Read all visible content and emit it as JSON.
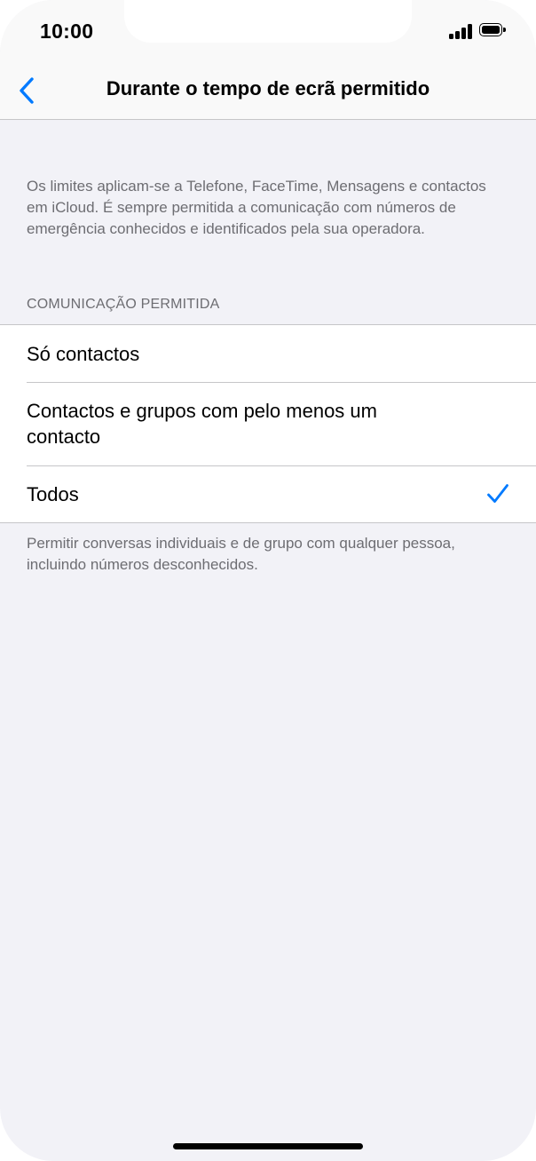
{
  "status_bar": {
    "time": "10:00",
    "signal_icon": "cellular-signal-icon",
    "battery_icon": "battery-full-icon"
  },
  "nav": {
    "back_icon": "chevron-left-icon",
    "title": "Durante o tempo de ecrã permitido",
    "accent_color": "#007aff"
  },
  "intro_note": "Os limites aplicam-se a Telefone, FaceTime, Mensagens e contactos em iCloud. É sempre permitida a comunicação com números de emergência conhecidos e identificados pela sua operadora.",
  "section": {
    "header": "COMUNICAÇÃO PERMITIDA",
    "options": [
      {
        "label": "Só contactos",
        "selected": false
      },
      {
        "label": "Contactos e grupos com pelo menos um contacto",
        "selected": false
      },
      {
        "label": "Todos",
        "selected": true
      }
    ],
    "check_icon": "checkmark-icon"
  },
  "footer_note": "Permitir conversas individuais e de grupo com qualquer pessoa, incluindo números desconhecidos."
}
